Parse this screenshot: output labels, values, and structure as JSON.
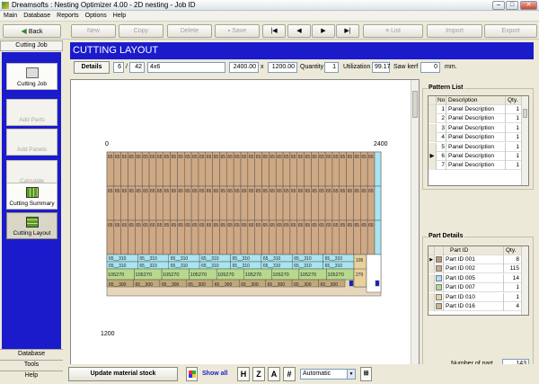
{
  "window": {
    "title": "Dreamsofts : Nesting Optimizer 4.00 - 2D nesting - Job ID",
    "minimize": "–",
    "maximize": "□",
    "close": "✕"
  },
  "menu": [
    "Main",
    "Database",
    "Reports",
    "Options",
    "Help"
  ],
  "toolbar": {
    "back": "Back",
    "new": "New",
    "copy": "Copy",
    "delete": "Delete",
    "save": "Save",
    "first": "|◀",
    "prev": "◀",
    "next": "▶",
    "last": "▶|",
    "list": "List",
    "import": "Import",
    "export": "Export"
  },
  "sidebar": {
    "header": "Cutting Job",
    "items": [
      {
        "label": "Cutting Job",
        "enabled": true
      },
      {
        "label": "Add Parts",
        "enabled": false
      },
      {
        "label": "Add Panels",
        "enabled": false
      },
      {
        "label": "Calculate",
        "enabled": false
      },
      {
        "label": "Cutting Summary",
        "enabled": true
      },
      {
        "label": "Cutting Layout",
        "enabled": true,
        "selected": true
      }
    ],
    "footer": [
      "Database",
      "Tools",
      "Help"
    ]
  },
  "main": {
    "title": "CUTTING LAYOUT",
    "details": {
      "button": "Details",
      "index": "6",
      "slash": "/",
      "total": "42",
      "name": "4x6",
      "width": "2400.00",
      "x": "x",
      "height": "1200.00",
      "qty_label": "Quantity",
      "qty": "1",
      "util_label": "Utilization",
      "util": "99.17",
      "kerf_label": "Saw kerf",
      "kerf": "0",
      "unit": "mm."
    }
  },
  "layout": {
    "x_start": "0",
    "x_end": "2400",
    "y_end": "1200",
    "tall_label": "65",
    "wide_top": "65__310",
    "green_label": "105270",
    "bottom_label": "65__300",
    "v105": "105",
    "v270": "270"
  },
  "pattern_list": {
    "title": "Pattern List",
    "columns": [
      "No",
      "Description",
      "Qty."
    ],
    "rows": [
      {
        "no": "1",
        "desc": "Panel Description",
        "qty": "1"
      },
      {
        "no": "2",
        "desc": "Panel Description",
        "qty": "1"
      },
      {
        "no": "3",
        "desc": "Panel Description",
        "qty": "1"
      },
      {
        "no": "4",
        "desc": "Panel Description",
        "qty": "1"
      },
      {
        "no": "5",
        "desc": "Panel Description",
        "qty": "1"
      },
      {
        "no": "6",
        "desc": "Panel Description",
        "qty": "1",
        "current": true
      },
      {
        "no": "7",
        "desc": "Panel Description",
        "qty": "1"
      }
    ]
  },
  "part_details": {
    "title": "Part Details",
    "columns": [
      "Part ID",
      "Qty."
    ],
    "rows": [
      {
        "color": "#b99a70",
        "id": "Part ID 001",
        "qty": "8",
        "current": true
      },
      {
        "color": "#cfa884",
        "id": "Part ID 002",
        "qty": "115"
      },
      {
        "color": "#a9e4f0",
        "id": "Part ID 005",
        "qty": "14"
      },
      {
        "color": "#b6d98d",
        "id": "Part ID 007",
        "qty": "1"
      },
      {
        "color": "#e8d19a",
        "id": "Part ID 010",
        "qty": "1"
      },
      {
        "color": "#c9b48d",
        "id": "Part ID 016",
        "qty": "4"
      }
    ],
    "number_label": "Number of part",
    "number": "143"
  },
  "bottom": {
    "update": "Update material stock",
    "show_all": "Show all",
    "h": "H",
    "z": "Z",
    "a": "A",
    "hash": "#",
    "mode": "Automatic"
  },
  "colors": {
    "brand_blue": "#1b1bcc",
    "tall_part": "#cfa884",
    "cyan_part": "#a9e4f0",
    "green_part": "#b6d98d",
    "bottom_part": "#c3a778",
    "edge_blue": "#1a1acc"
  }
}
